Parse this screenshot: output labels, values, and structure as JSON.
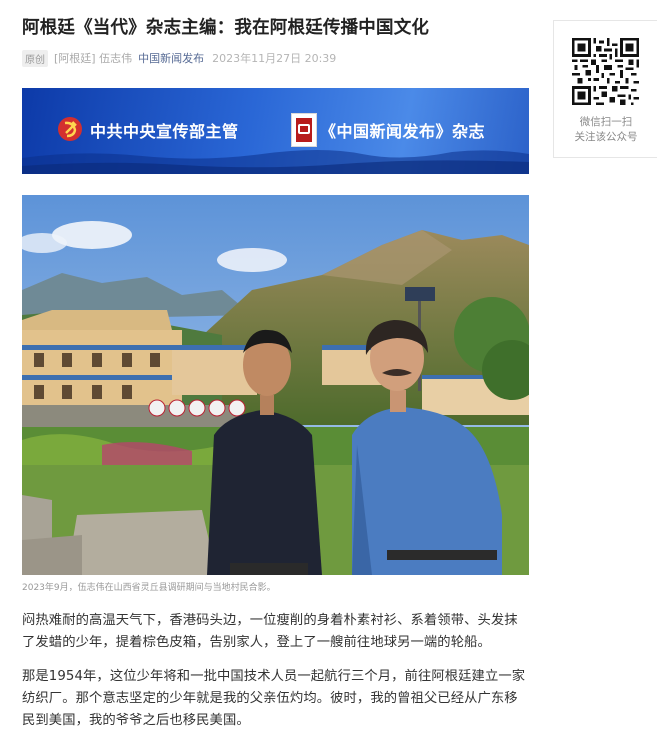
{
  "article": {
    "title": "阿根廷《当代》杂志主编：我在阿根廷传播中国文化",
    "meta": {
      "badge": "原创",
      "source": "[阿根廷] 伍志伟",
      "account": "中国新闻发布",
      "time": "2023年11月27日 20:39"
    },
    "banner": {
      "left_text": "中共中央宣传部主管",
      "right_text": "《中国新闻发布》杂志"
    },
    "photo_caption": "2023年9月，伍志伟在山西省灵丘县调研期间与当地村民合影。",
    "paragraphs": [
      {
        "lines": [
          "闷热难耐的高温天气下，香港码头边，一位瘦削的身着朴素衬衫、系着领带、头发抹",
          "了发蜡的少年，提着棕色皮箱，告别家人，登上了一艘前往地球另一端的轮船。"
        ]
      },
      {
        "lines": [
          "那是1954年，这位少年将和一批中国技术人员一起航行三个月，前往阿根廷建立一家",
          "纺织厂。那个意志坚定的少年就是我的父亲伍灼均。彼时，我的曾祖父已经从广东移",
          "民到美国，我的爷爷之后也移民美国。"
        ]
      }
    ]
  },
  "sidebar": {
    "qr_line1": "微信扫一扫",
    "qr_line2": "关注该公众号"
  },
  "icons": {
    "emblem": "hammer-sickle-icon",
    "seal": "china-press-seal-icon",
    "qr": "qr-code"
  },
  "colors": {
    "link": "#576b95",
    "banner": "#2a67d6"
  }
}
